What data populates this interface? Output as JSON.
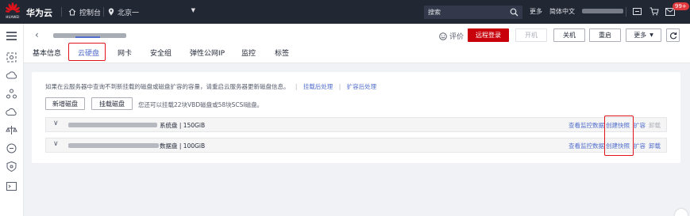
{
  "topbar": {
    "logo_text": "HUAWEI",
    "brand": "华为云",
    "console_label": "控制台",
    "region": "北京一",
    "search_placeholder": "搜索",
    "more": "更多",
    "language": "简体中文",
    "badge": "99+"
  },
  "header": {
    "rate_label": "评价",
    "buttons": {
      "remote_login": "远程登录",
      "power_on": "开机",
      "power_off": "关机",
      "restart": "重启",
      "more": "更多"
    },
    "tabs": [
      "基本信息",
      "云硬盘",
      "网卡",
      "安全组",
      "弹性公网IP",
      "监控",
      "标签"
    ],
    "active_tab": "云硬盘"
  },
  "disks_panel": {
    "info": "如果在云服务器中查询不到新挂载的磁盘或磁盘扩容的容量，请重启云服务器更新磁盘信息。",
    "info_link_mount": "挂载后处理",
    "info_link_expand": "扩容后处理",
    "add_disk": "新增磁盘",
    "attach_disk": "挂载磁盘",
    "hint": "您还可以挂载22块VBD磁盘或58块SCSI磁盘。",
    "rows": [
      {
        "info": "系统盘 | 150GiB",
        "actions": [
          "查看监控数据",
          "创建快照",
          "扩容",
          "卸载"
        ],
        "unmount_enabled": false
      },
      {
        "info": "数据盘 | 100GiB",
        "actions": [
          "查看监控数据",
          "创建快照",
          "扩容",
          "卸载"
        ],
        "unmount_enabled": true
      }
    ]
  },
  "colors": {
    "topbar_bg": "#222734",
    "primary_red": "#c7000b",
    "link_blue": "#526ecc",
    "highlight_box": "#e0131b"
  }
}
